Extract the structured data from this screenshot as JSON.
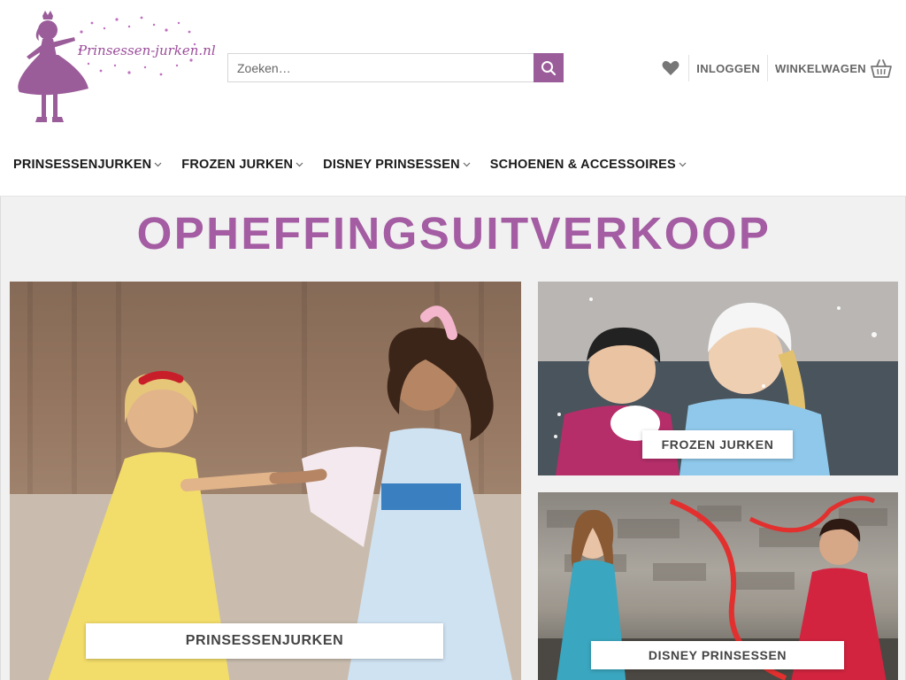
{
  "logo": {
    "text": "Prinsessen-jurken.nl"
  },
  "search": {
    "placeholder": "Zoeken…"
  },
  "header": {
    "login_label": "INLOGGEN",
    "cart_label": "WINKELWAGEN"
  },
  "nav": {
    "items": [
      {
        "label": "PRINSESSENJURKEN"
      },
      {
        "label": "FROZEN JURKEN"
      },
      {
        "label": "DISNEY PRINSESSEN"
      },
      {
        "label": "SCHOENEN & ACCESSOIRES"
      }
    ]
  },
  "main": {
    "title": "OPHEFFINGSUITVERKOOP",
    "tiles": [
      {
        "label": "PRINSESSENJURKEN"
      },
      {
        "label": "FROZEN JURKEN"
      },
      {
        "label": "DISNEY PRINSESSEN"
      }
    ]
  },
  "colors": {
    "accent": "#9b5d9a",
    "title": "#a45ca3",
    "background": "#f1f1f1"
  }
}
